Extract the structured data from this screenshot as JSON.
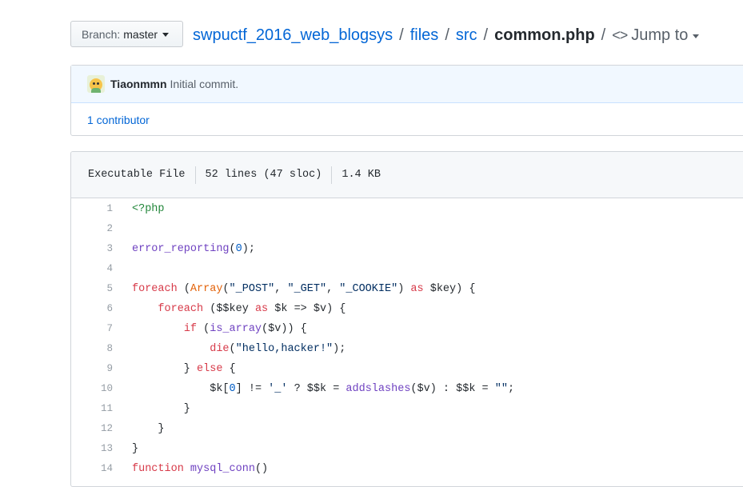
{
  "branch": {
    "label": "Branch:",
    "value": "master"
  },
  "breadcrumb": {
    "repo": "swpuctf_2016_web_blogsys",
    "dir1": "files",
    "dir2": "src",
    "file": "common.php",
    "sep": "/",
    "jump_icon": "<>",
    "jump_label": "Jump to"
  },
  "commit": {
    "avatar_icon": "user-avatar",
    "author": "Tiaonmmn",
    "message": "Initial commit."
  },
  "contributors": "1 contributor",
  "file_info": {
    "mode": "Executable File",
    "lines": "52 lines (47 sloc)",
    "size": "1.4 KB"
  },
  "code": {
    "line_numbers": [
      "1",
      "2",
      "3",
      "4",
      "5",
      "6",
      "7",
      "8",
      "9",
      "10",
      "11",
      "12",
      "13",
      "14"
    ],
    "l1": {
      "a": "<?php"
    },
    "l3": {
      "a": "error_reporting",
      "b": "(",
      "c": "0",
      "d": ");"
    },
    "l5": {
      "a": "foreach",
      "b": " (",
      "c": "Array",
      "d": "(",
      "e": "\"_POST\"",
      "f": ", ",
      "g": "\"_GET\"",
      "h": ", ",
      "i": "\"_COOKIE\"",
      "j": ") ",
      "k": "as",
      "l": " ",
      "m": "$key",
      "n": ") {"
    },
    "l6": {
      "a": "    ",
      "b": "foreach",
      "c": " (",
      "d": "$$key",
      "e": " ",
      "f": "as",
      "g": " ",
      "h": "$k",
      "i": " => ",
      "j": "$v",
      "k": ") {"
    },
    "l7": {
      "a": "        ",
      "b": "if",
      "c": " (",
      "d": "is_array",
      "e": "(",
      "f": "$v",
      "g": ")) {"
    },
    "l8": {
      "a": "            ",
      "b": "die",
      "c": "(",
      "d": "\"hello,hacker!\"",
      "e": ");"
    },
    "l9": {
      "a": "        } ",
      "b": "else",
      "c": " {"
    },
    "l10": {
      "a": "            ",
      "b": "$k",
      "c": "[",
      "d": "0",
      "e": "] != ",
      "f": "'_'",
      "g": " ? ",
      "h": "$$k",
      "i": " = ",
      "j": "addslashes",
      "k": "(",
      "l": "$v",
      "m": ") : ",
      "n": "$$k",
      "o": " = ",
      "p": "\"\"",
      "q": ";"
    },
    "l11": {
      "a": "        }"
    },
    "l12": {
      "a": "    }"
    },
    "l13": {
      "a": "}"
    },
    "l14": {
      "a": "function",
      "b": " ",
      "c": "mysql_conn",
      "d": "()"
    }
  }
}
